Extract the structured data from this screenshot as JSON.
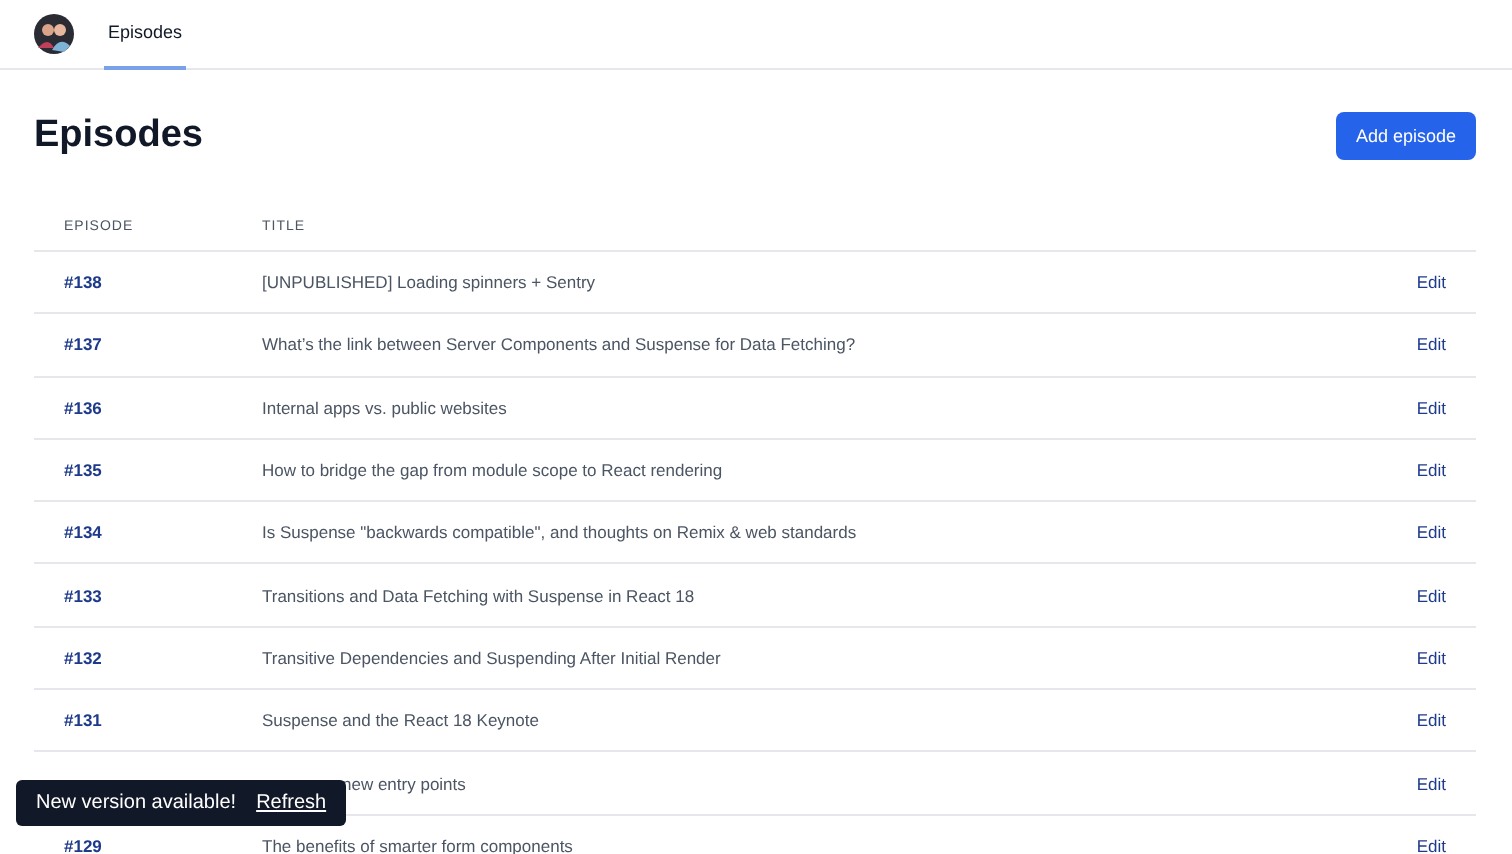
{
  "nav": {
    "tabs": [
      {
        "label": "Episodes",
        "selected": true
      }
    ]
  },
  "page": {
    "title": "Episodes",
    "primary_button": "Add episode"
  },
  "table": {
    "columns": [
      "EPISODE",
      "TITLE"
    ],
    "rows": [
      {
        "episode": "#138",
        "title": "[UNPUBLISHED] Loading spinners + Sentry",
        "action": "Edit"
      },
      {
        "episode": "#137",
        "title": "What’s the link between Server Components and Suspense for Data Fetching?",
        "action": "Edit"
      },
      {
        "episode": "#136",
        "title": "Internal apps vs. public websites",
        "action": "Edit"
      },
      {
        "episode": "#135",
        "title": "How to bridge the gap from module scope to React rendering",
        "action": "Edit"
      },
      {
        "episode": "#134",
        "title": "Is Suspense \"backwards compatible\", and thoughts on Remix & web standards",
        "action": "Edit"
      },
      {
        "episode": "#133",
        "title": "Transitions and Data Fetching with Suspense in React 18",
        "action": "Edit"
      },
      {
        "episode": "#132",
        "title": "Transitive Dependencies and Suspending After Initial Render",
        "action": "Edit"
      },
      {
        "episode": "#131",
        "title": "Suspense and the React 18 Keynote",
        "action": "Edit"
      },
      {
        "title": "new entry points",
        "covered": true,
        "action": "Edit"
      },
      {
        "episode": "#129",
        "title": "The benefits of smarter form components",
        "action": "Edit"
      }
    ]
  },
  "toast": {
    "message": "New version available!",
    "action": "Refresh"
  }
}
